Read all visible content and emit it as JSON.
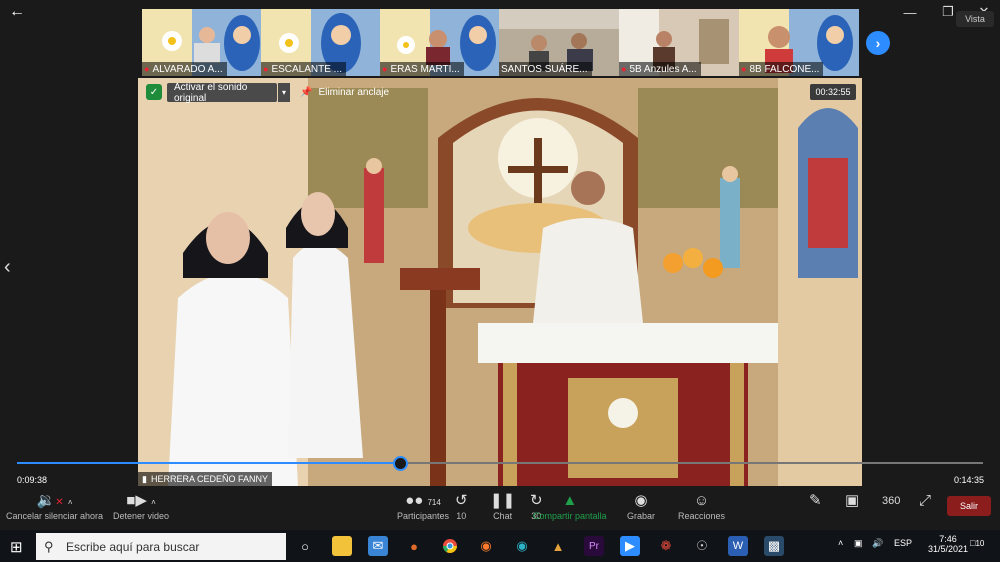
{
  "window": {
    "minimize_icon": "minimize-icon",
    "restore_icon": "restore-icon",
    "close_icon": "close-icon",
    "back_icon": "arrow-left-icon"
  },
  "gallery": [
    {
      "name": "ALVARADO A...",
      "muted": true
    },
    {
      "name": "ESCALANTE ...",
      "muted": true
    },
    {
      "name": "ERAS MARTI...",
      "muted": true
    },
    {
      "name": "SANTOS SUÁRE...",
      "muted": false
    },
    {
      "name": "5B Anzules A...",
      "muted": true
    },
    {
      "name": "8B FALCONE...",
      "muted": true
    }
  ],
  "view_button": "Vista",
  "video": {
    "audio_button": "Activar el sonido original",
    "unpin_button": "Eliminar anclaje",
    "recording_time": "00:32:55",
    "speaker_name": "HERRERA CEDEÑO FANNY"
  },
  "playback": {
    "current_time": "0:09:38",
    "total_time": "0:14:35",
    "progress": 0.396
  },
  "controls": {
    "mute": "Cancelar silenciar ahora",
    "video": "Detener video",
    "participants": "Participantes",
    "participants_count": "714",
    "rewind_seconds": "10",
    "chat": "Chat",
    "forward_seconds": "30",
    "share": "Compartir pantalla",
    "record": "Grabar",
    "reactions": "Reacciones",
    "end": "Salir"
  },
  "taskbar": {
    "search_placeholder": "Escribe aquí para buscar",
    "language": "ESP",
    "time": "7:46",
    "date": "31/5/2021",
    "notifications": "10"
  },
  "colors": {
    "accent": "#2d8cff",
    "share_green": "#1fa04a",
    "end_red": "#8b1d1d",
    "mute_red": "#e22233"
  }
}
